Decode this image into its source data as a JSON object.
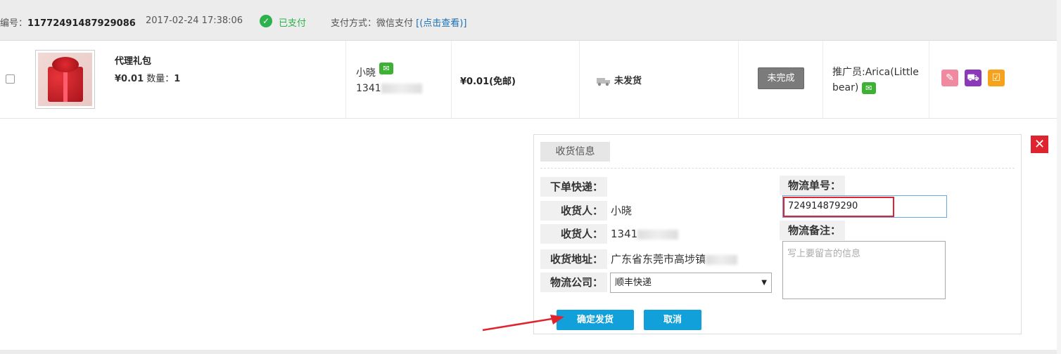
{
  "header": {
    "order_no_label": "编号：",
    "order_no": "11772491487929086",
    "datetime": "2017-02-24 17:38:06",
    "paid_status": "已支付",
    "pay_method_label": "支付方式：微信支付",
    "pay_method_link": "[(点击查看)]"
  },
  "order": {
    "product_name": "代理礼包",
    "price": "¥0.01",
    "qty_label": "数量：",
    "qty": "1",
    "buyer_name": "小晓",
    "buyer_phone": "1341",
    "amount": "¥0.01(免邮)",
    "ship_state": "未发货",
    "status_button": "未完成",
    "promoter": "推广员:Arica(Little bear)"
  },
  "panel": {
    "title": "收货信息",
    "labels": {
      "express": "下单快递：",
      "receiver": "收货人：",
      "phone": "收货人：",
      "address": "收货地址：",
      "company": "物流公司：",
      "tracking": "物流单号：",
      "note": "物流备注："
    },
    "values": {
      "receiver": "小晓",
      "phone": "1341",
      "address": "广东省东莞市高埗镇",
      "company": "顺丰快递",
      "tracking": "724914879290"
    },
    "note_placeholder": "写上要留言的信息",
    "confirm_button": "确定发货",
    "cancel_button": "取消",
    "close": "✕"
  },
  "colors": {
    "accent_blue": "#12a0db",
    "paid_green": "#2bb24c",
    "highlight_red": "#e0242f"
  }
}
